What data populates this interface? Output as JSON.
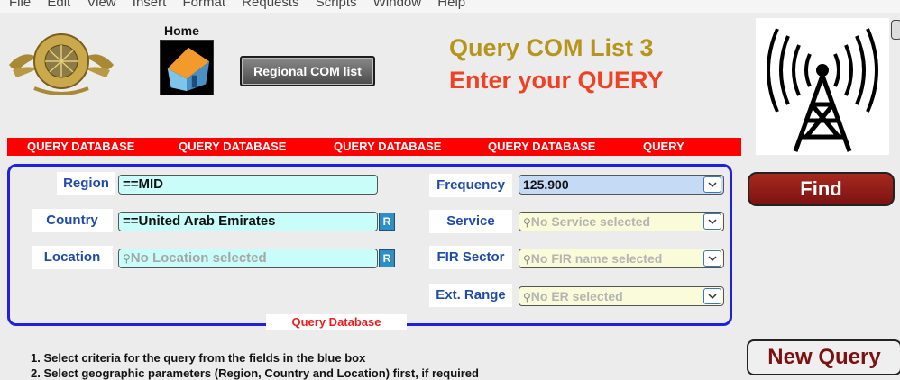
{
  "menu": {
    "items": [
      "File",
      "Edit",
      "View",
      "Insert",
      "Format",
      "Requests",
      "Scripts",
      "Window",
      "Help"
    ]
  },
  "header": {
    "home_label": "Home",
    "regional_button": "Regional COM list",
    "title_line1": "Query COM List 3",
    "title_line2": "Enter your QUERY"
  },
  "tabs": [
    "QUERY DATABASE",
    "QUERY DATABASE",
    "QUERY DATABASE",
    "QUERY DATABASE",
    "QUERY"
  ],
  "form": {
    "region": {
      "label": "Region",
      "value": "==MID"
    },
    "country": {
      "label": "Country",
      "value": "==United Arab Emirates",
      "r_button": "R"
    },
    "location": {
      "label": "Location",
      "placeholder": "No Location selected",
      "r_button": "R"
    },
    "frequency": {
      "label": "Frequency",
      "value": "125.900"
    },
    "service": {
      "label": "Service",
      "placeholder": "No Service selected"
    },
    "fir_sector": {
      "label": "FIR Sector",
      "placeholder": "No FIR name selected"
    },
    "ext_range": {
      "label": "Ext. Range",
      "placeholder": "No ER selected"
    },
    "box_label": "Query Database"
  },
  "buttons": {
    "find": "Find",
    "new_query": "New Query"
  },
  "instructions": [
    "1.   Select criteria for the query from the fields in the blue box",
    "2.   Select geographic parameters (Region, Country and Location) first, if required"
  ],
  "colors": {
    "tab_bar": "#ff0000",
    "box_border": "#2020e0",
    "title1": "#b6951c",
    "title2": "#ef4123"
  }
}
